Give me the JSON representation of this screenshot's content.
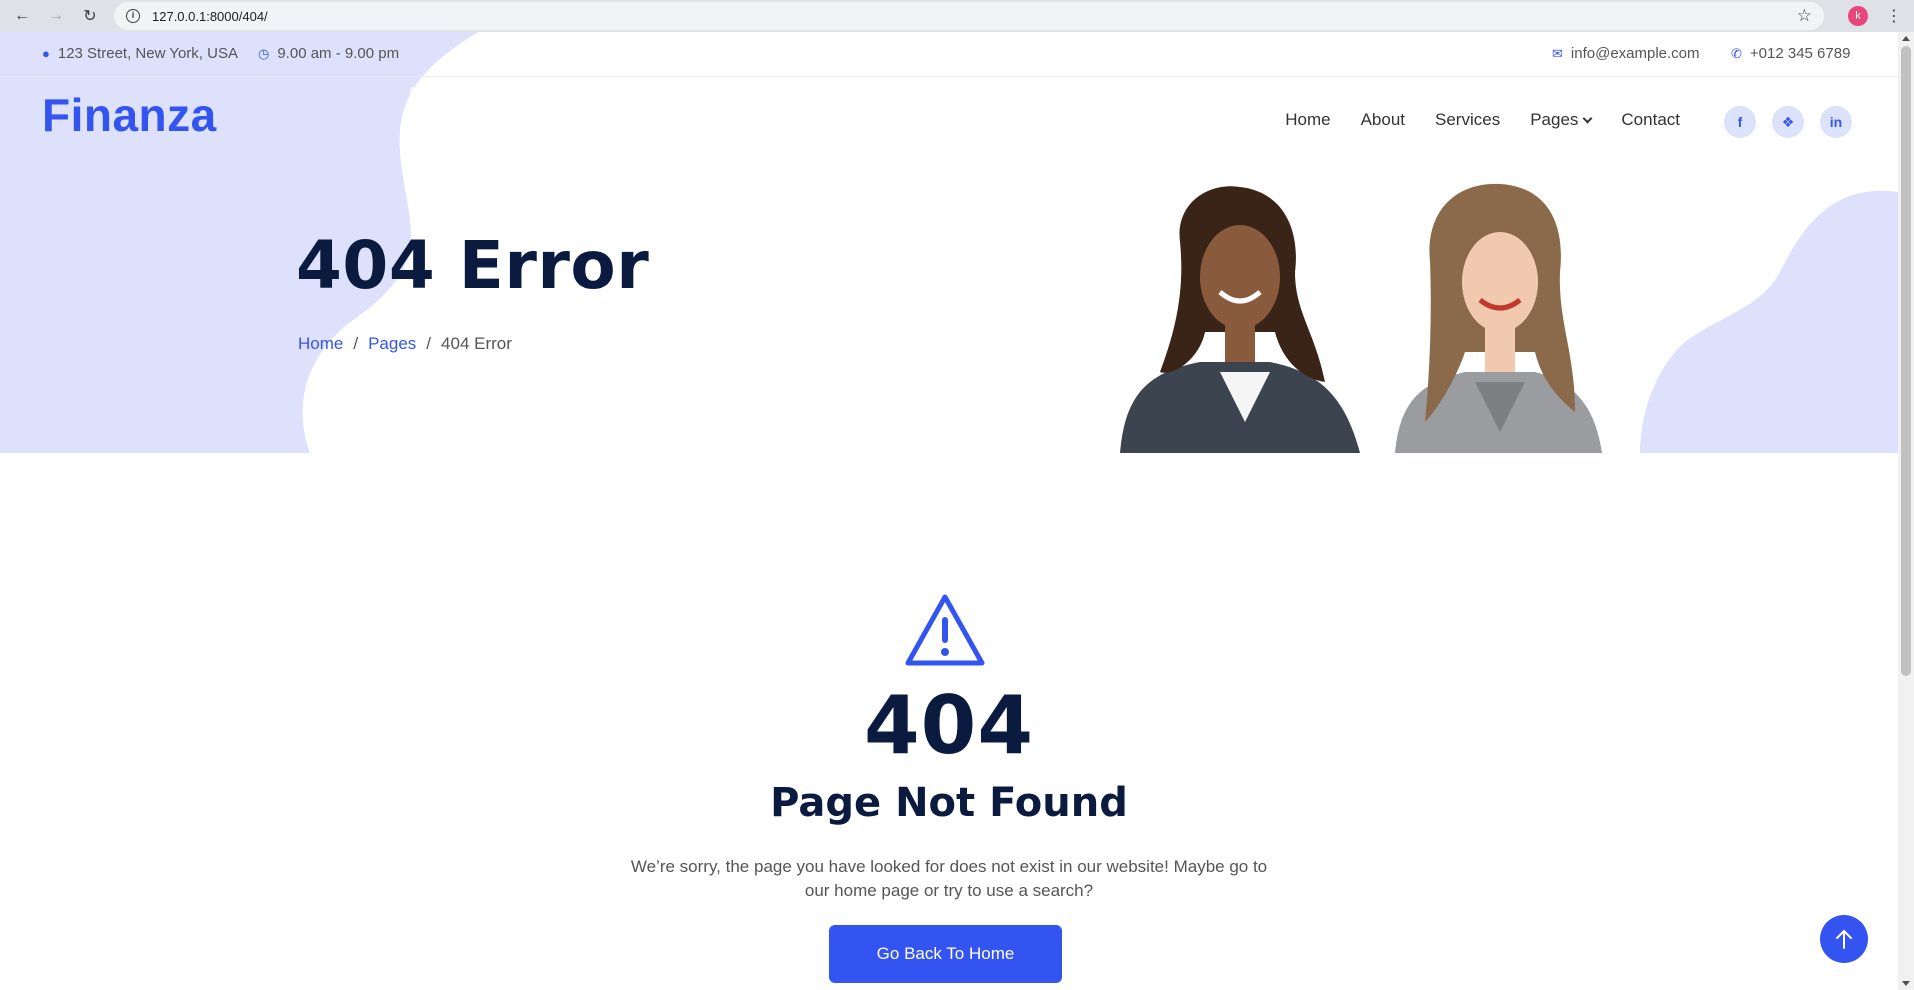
{
  "browser": {
    "url": "127.0.0.1:8000/404/",
    "profile_initial": "k"
  },
  "topbar": {
    "address": "123 Street, New York, USA",
    "hours": "9.00 am - 9.00 pm",
    "email": "info@example.com",
    "phone": "+012 345 6789"
  },
  "brand": {
    "name": "Finanza"
  },
  "nav": {
    "items": [
      "Home",
      "About",
      "Services",
      "Pages",
      "Contact"
    ]
  },
  "social": [
    "facebook-icon",
    "twitter-icon",
    "linkedin-icon"
  ],
  "hero": {
    "title": "404 Error",
    "breadcrumb": [
      "Home",
      "Pages",
      "404 Error"
    ],
    "breadcrumb_sep": "/"
  },
  "error": {
    "code": "404",
    "heading": "Page Not Found",
    "message": "We’re sorry, the page you have looked for does not exist in our website! Maybe go to our home page or try to use a search?",
    "button": "Go Back To Home"
  },
  "colors": {
    "primary": "#3454f1",
    "dark": "#0b1b3f",
    "hero_bg": "#dde1fb"
  }
}
